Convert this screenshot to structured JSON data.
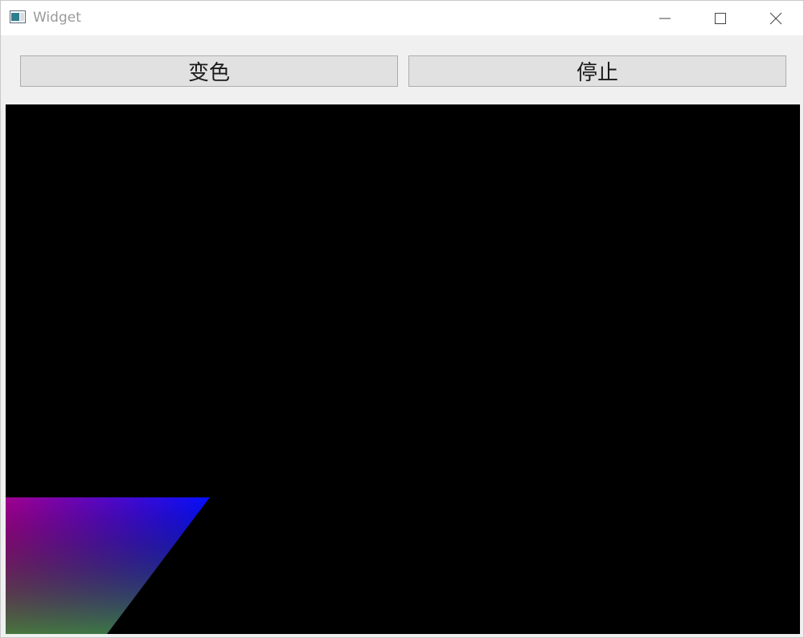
{
  "window": {
    "title": "Widget"
  },
  "controls": {
    "color_button_label": "变色",
    "stop_button_label": "停止"
  },
  "canvas": {
    "background": "#000000",
    "gradient_colors": {
      "top_left": "#a00090",
      "top_right": "#0010ff",
      "bottom_left": "#3a8a30",
      "bottom_right": "#008a8a"
    }
  },
  "icons": {
    "app": "window-icon",
    "minimize": "minimize-icon",
    "maximize": "maximize-icon",
    "close": "close-icon"
  }
}
